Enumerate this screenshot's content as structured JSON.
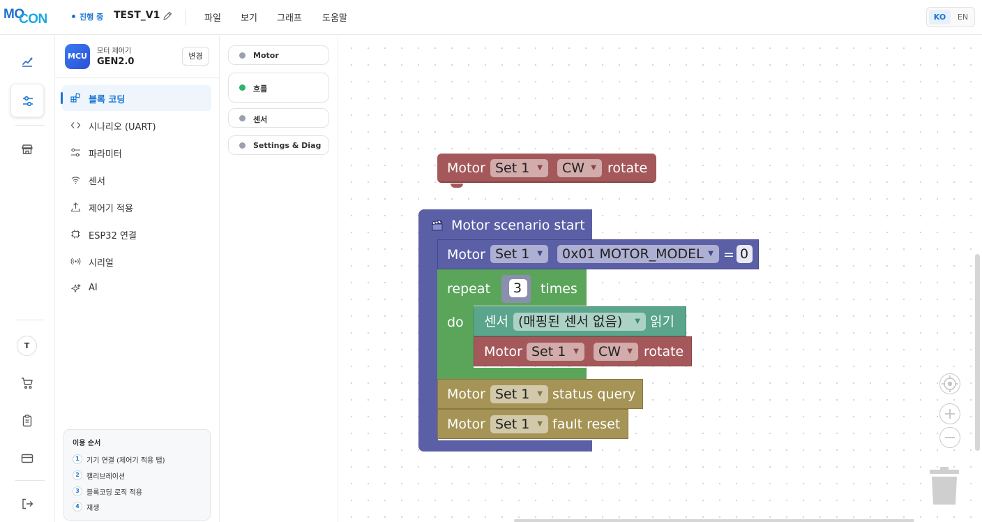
{
  "header": {
    "logo_part1": "MO",
    "logo_part2": "CON",
    "status": "진행 중",
    "project_title": "TEST_V1",
    "menu": [
      "파일",
      "보기",
      "그래프",
      "도움말"
    ],
    "lang_ko": "KO",
    "lang_en": "EN"
  },
  "rail": {
    "icons": [
      "chart-edit-icon",
      "sliders-icon",
      "store-icon",
      "cart-icon",
      "clipboard-icon",
      "card-icon",
      "logout-icon"
    ],
    "avatar": "T"
  },
  "sidebar": {
    "badge": "MCU",
    "controller_label": "모터 제어기",
    "controller_model": "GEN2.0",
    "change_button": "변경",
    "items": [
      {
        "label": "블록 코딩",
        "icon": "blocks-icon",
        "active": true
      },
      {
        "label": "시나리오 (UART)",
        "icon": "code-icon",
        "active": false
      },
      {
        "label": "파라미터",
        "icon": "params-icon",
        "active": false
      },
      {
        "label": "센서",
        "icon": "wifi-icon",
        "active": false
      },
      {
        "label": "제어기 적용",
        "icon": "upload-icon",
        "active": false
      },
      {
        "label": "ESP32 연결",
        "icon": "chip-icon",
        "active": false
      },
      {
        "label": "시리얼",
        "icon": "radio-icon",
        "active": false
      },
      {
        "label": "AI",
        "icon": "sparkle-icon",
        "active": false
      }
    ],
    "guide": {
      "title": "이용 순서",
      "steps": [
        {
          "num": "1",
          "text": "기기 연결 (제어기 적용 탭)"
        },
        {
          "num": "2",
          "text": "캘리브레이션"
        },
        {
          "num": "3",
          "text": "블록코딩 로직 적용"
        },
        {
          "num": "4",
          "text": "재생"
        }
      ]
    }
  },
  "categories": [
    {
      "label": "Motor",
      "color": "#9aa0b0"
    },
    {
      "label": "흐름",
      "color": "#2db36a"
    },
    {
      "label": "센서",
      "color": "#9aa0b0"
    },
    {
      "label": "Settings & Diag",
      "color": "#9aa0b0"
    }
  ],
  "colors": {
    "motor_block": "#a5585a",
    "scenario_block": "#5b5fa6",
    "loop_block": "#5ba55b",
    "sensor_block": "#5ba58c",
    "diag_block": "#a59456",
    "accent": "#1976d2"
  },
  "blocks": {
    "standalone": {
      "word": "Motor",
      "set": "Set 1",
      "dir": "CW",
      "action": "rotate"
    },
    "scenario": {
      "title": "Motor scenario start",
      "param": {
        "word": "Motor",
        "set": "Set 1",
        "param": "0x01 MOTOR_MODEL",
        "eq": "=",
        "value": "0"
      },
      "repeat": {
        "word": "repeat",
        "count": "3",
        "times": "times",
        "do": "do"
      },
      "sensor": {
        "word": "센서",
        "source": "(매핑된 센서 없음)",
        "read": "읽기"
      },
      "inner_motor": {
        "word": "Motor",
        "set": "Set 1",
        "dir": "CW",
        "action": "rotate"
      },
      "status": {
        "word": "Motor",
        "set": "Set 1",
        "action": "status query"
      },
      "fault": {
        "word": "Motor",
        "set": "Set 1",
        "action": "fault reset"
      }
    }
  }
}
